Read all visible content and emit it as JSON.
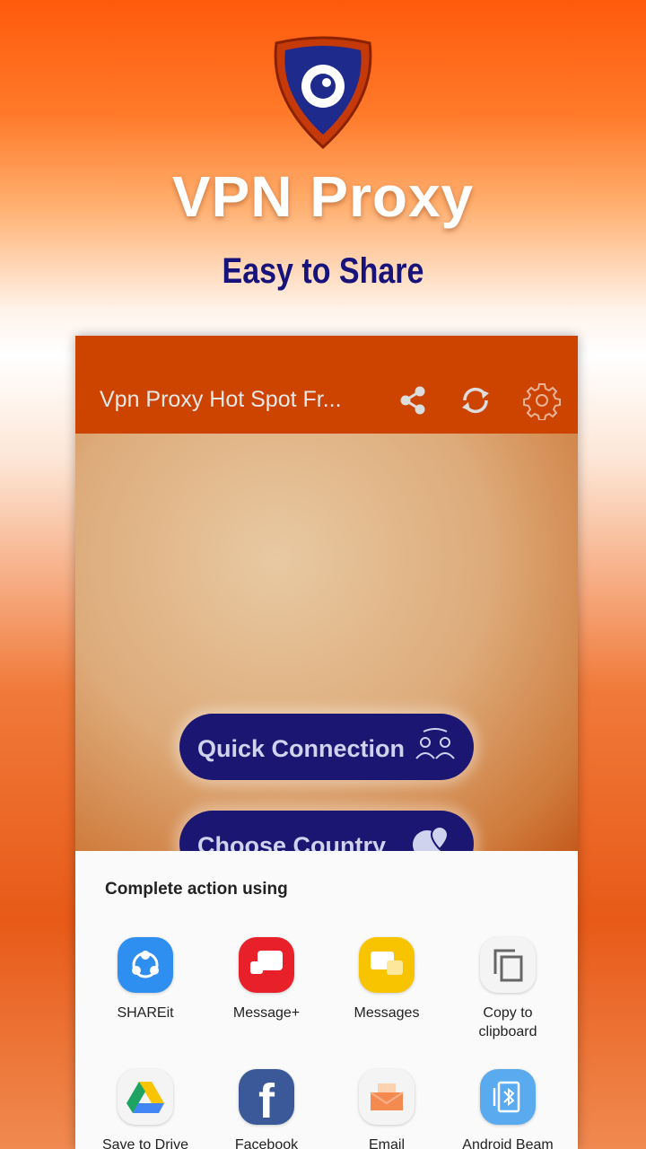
{
  "promo": {
    "title": "VPN Proxy",
    "subtitle": "Easy to Share"
  },
  "toolbar": {
    "title": "Vpn Proxy Hot Spot Fr...",
    "actions": [
      "share-icon",
      "refresh-icon",
      "settings-icon"
    ],
    "color": "#cc4400"
  },
  "main": {
    "buttons": [
      {
        "label": "Quick Connection",
        "icon": "users-connect-icon"
      },
      {
        "label": "Choose Country",
        "icon": "globe-pin-icon"
      }
    ],
    "accent": "#1a1672"
  },
  "share_sheet": {
    "title": "Complete action using",
    "apps": [
      {
        "label": "SHAREit",
        "icon": "shareit-icon",
        "color": "#2f8ff0"
      },
      {
        "label": "Message+",
        "icon": "message-plus-icon",
        "color": "#e8202a"
      },
      {
        "label": "Messages",
        "icon": "messages-icon",
        "color": "#f8c400"
      },
      {
        "label": "Copy to clipboard",
        "icon": "copy-icon",
        "color": "#f4f4f4"
      },
      {
        "label": "Save to Drive",
        "icon": "drive-icon",
        "color": "#f4f4f4"
      },
      {
        "label": "Facebook",
        "icon": "facebook-icon",
        "color": "#3b5998"
      },
      {
        "label": "Email",
        "icon": "email-icon",
        "color": "#f4f4f4"
      },
      {
        "label": "Android Beam",
        "icon": "android-beam-icon",
        "color": "#5aaaf0"
      }
    ]
  }
}
